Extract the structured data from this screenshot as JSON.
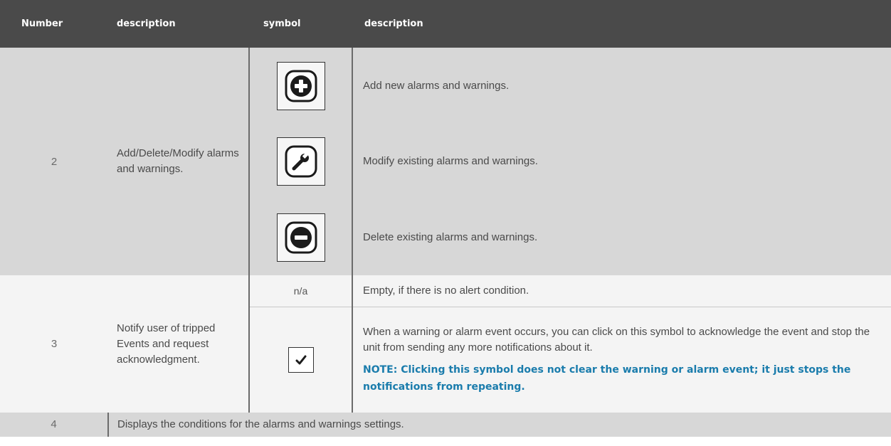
{
  "header": {
    "col1": "Number",
    "col2": "description",
    "col3": "symbol",
    "col4": "description"
  },
  "rows": [
    {
      "number": "2",
      "description": "Add/Delete/Modify alarms and warnings.",
      "items": [
        {
          "icon": "add-icon",
          "text": "Add new alarms and warnings."
        },
        {
          "icon": "wrench-icon",
          "text": "Modify existing alarms and warnings."
        },
        {
          "icon": "minus-icon",
          "text": "Delete existing alarms and warnings."
        }
      ]
    },
    {
      "number": "3",
      "description": "Notify user of tripped Events and request acknowledgment.",
      "items": [
        {
          "symbol": "n/a",
          "text": "Empty, if there is no alert condition."
        },
        {
          "icon": "checkmark-icon",
          "text": "When a warning or alarm event occurs, you can click on this symbol to acknowledge the event and stop the unit from sending any more notifications about it.",
          "note": "NOTE: Clicking this symbol does not clear the warning or alarm event; it just stops the notifications from repeating."
        }
      ]
    },
    {
      "number": "4",
      "description": "Displays the conditions for the alarms and warnings settings."
    }
  ],
  "colors": {
    "header_bg": "#4a4a4a",
    "gray_row": "#d7d7d7",
    "note": "#1a7cac"
  }
}
